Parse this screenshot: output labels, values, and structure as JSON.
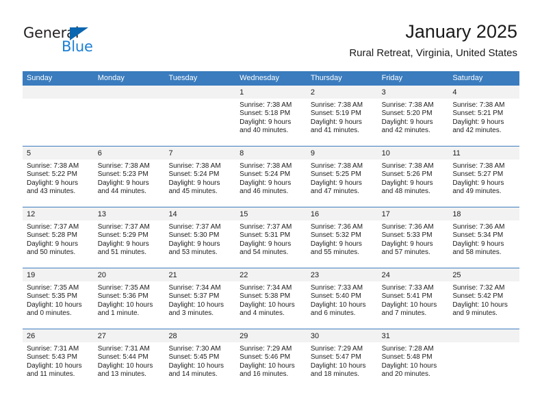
{
  "brand": {
    "name_top": "General",
    "name_bottom": "Blue",
    "triangle_color": "#0a66b0",
    "blue_text_color": "#1b7fd4"
  },
  "header": {
    "title": "January 2025",
    "subtitle": "Rural Retreat, Virginia, United States"
  },
  "theme": {
    "header_blue": "#3a7cbe",
    "day_number_band": "#f2f2f2",
    "text": "#1a1a1a"
  },
  "weekdays": [
    "Sunday",
    "Monday",
    "Tuesday",
    "Wednesday",
    "Thursday",
    "Friday",
    "Saturday"
  ],
  "weeks": [
    [
      {
        "empty": true
      },
      {
        "empty": true
      },
      {
        "empty": true
      },
      {
        "day": "1",
        "sunrise": "Sunrise: 7:38 AM",
        "sunset": "Sunset: 5:18 PM",
        "daylight1": "Daylight: 9 hours",
        "daylight2": "and 40 minutes."
      },
      {
        "day": "2",
        "sunrise": "Sunrise: 7:38 AM",
        "sunset": "Sunset: 5:19 PM",
        "daylight1": "Daylight: 9 hours",
        "daylight2": "and 41 minutes."
      },
      {
        "day": "3",
        "sunrise": "Sunrise: 7:38 AM",
        "sunset": "Sunset: 5:20 PM",
        "daylight1": "Daylight: 9 hours",
        "daylight2": "and 42 minutes."
      },
      {
        "day": "4",
        "sunrise": "Sunrise: 7:38 AM",
        "sunset": "Sunset: 5:21 PM",
        "daylight1": "Daylight: 9 hours",
        "daylight2": "and 42 minutes."
      }
    ],
    [
      {
        "day": "5",
        "sunrise": "Sunrise: 7:38 AM",
        "sunset": "Sunset: 5:22 PM",
        "daylight1": "Daylight: 9 hours",
        "daylight2": "and 43 minutes."
      },
      {
        "day": "6",
        "sunrise": "Sunrise: 7:38 AM",
        "sunset": "Sunset: 5:23 PM",
        "daylight1": "Daylight: 9 hours",
        "daylight2": "and 44 minutes."
      },
      {
        "day": "7",
        "sunrise": "Sunrise: 7:38 AM",
        "sunset": "Sunset: 5:24 PM",
        "daylight1": "Daylight: 9 hours",
        "daylight2": "and 45 minutes."
      },
      {
        "day": "8",
        "sunrise": "Sunrise: 7:38 AM",
        "sunset": "Sunset: 5:24 PM",
        "daylight1": "Daylight: 9 hours",
        "daylight2": "and 46 minutes."
      },
      {
        "day": "9",
        "sunrise": "Sunrise: 7:38 AM",
        "sunset": "Sunset: 5:25 PM",
        "daylight1": "Daylight: 9 hours",
        "daylight2": "and 47 minutes."
      },
      {
        "day": "10",
        "sunrise": "Sunrise: 7:38 AM",
        "sunset": "Sunset: 5:26 PM",
        "daylight1": "Daylight: 9 hours",
        "daylight2": "and 48 minutes."
      },
      {
        "day": "11",
        "sunrise": "Sunrise: 7:38 AM",
        "sunset": "Sunset: 5:27 PM",
        "daylight1": "Daylight: 9 hours",
        "daylight2": "and 49 minutes."
      }
    ],
    [
      {
        "day": "12",
        "sunrise": "Sunrise: 7:37 AM",
        "sunset": "Sunset: 5:28 PM",
        "daylight1": "Daylight: 9 hours",
        "daylight2": "and 50 minutes."
      },
      {
        "day": "13",
        "sunrise": "Sunrise: 7:37 AM",
        "sunset": "Sunset: 5:29 PM",
        "daylight1": "Daylight: 9 hours",
        "daylight2": "and 51 minutes."
      },
      {
        "day": "14",
        "sunrise": "Sunrise: 7:37 AM",
        "sunset": "Sunset: 5:30 PM",
        "daylight1": "Daylight: 9 hours",
        "daylight2": "and 53 minutes."
      },
      {
        "day": "15",
        "sunrise": "Sunrise: 7:37 AM",
        "sunset": "Sunset: 5:31 PM",
        "daylight1": "Daylight: 9 hours",
        "daylight2": "and 54 minutes."
      },
      {
        "day": "16",
        "sunrise": "Sunrise: 7:36 AM",
        "sunset": "Sunset: 5:32 PM",
        "daylight1": "Daylight: 9 hours",
        "daylight2": "and 55 minutes."
      },
      {
        "day": "17",
        "sunrise": "Sunrise: 7:36 AM",
        "sunset": "Sunset: 5:33 PM",
        "daylight1": "Daylight: 9 hours",
        "daylight2": "and 57 minutes."
      },
      {
        "day": "18",
        "sunrise": "Sunrise: 7:36 AM",
        "sunset": "Sunset: 5:34 PM",
        "daylight1": "Daylight: 9 hours",
        "daylight2": "and 58 minutes."
      }
    ],
    [
      {
        "day": "19",
        "sunrise": "Sunrise: 7:35 AM",
        "sunset": "Sunset: 5:35 PM",
        "daylight1": "Daylight: 10 hours",
        "daylight2": "and 0 minutes."
      },
      {
        "day": "20",
        "sunrise": "Sunrise: 7:35 AM",
        "sunset": "Sunset: 5:36 PM",
        "daylight1": "Daylight: 10 hours",
        "daylight2": "and 1 minute."
      },
      {
        "day": "21",
        "sunrise": "Sunrise: 7:34 AM",
        "sunset": "Sunset: 5:37 PM",
        "daylight1": "Daylight: 10 hours",
        "daylight2": "and 3 minutes."
      },
      {
        "day": "22",
        "sunrise": "Sunrise: 7:34 AM",
        "sunset": "Sunset: 5:38 PM",
        "daylight1": "Daylight: 10 hours",
        "daylight2": "and 4 minutes."
      },
      {
        "day": "23",
        "sunrise": "Sunrise: 7:33 AM",
        "sunset": "Sunset: 5:40 PM",
        "daylight1": "Daylight: 10 hours",
        "daylight2": "and 6 minutes."
      },
      {
        "day": "24",
        "sunrise": "Sunrise: 7:33 AM",
        "sunset": "Sunset: 5:41 PM",
        "daylight1": "Daylight: 10 hours",
        "daylight2": "and 7 minutes."
      },
      {
        "day": "25",
        "sunrise": "Sunrise: 7:32 AM",
        "sunset": "Sunset: 5:42 PM",
        "daylight1": "Daylight: 10 hours",
        "daylight2": "and 9 minutes."
      }
    ],
    [
      {
        "day": "26",
        "sunrise": "Sunrise: 7:31 AM",
        "sunset": "Sunset: 5:43 PM",
        "daylight1": "Daylight: 10 hours",
        "daylight2": "and 11 minutes."
      },
      {
        "day": "27",
        "sunrise": "Sunrise: 7:31 AM",
        "sunset": "Sunset: 5:44 PM",
        "daylight1": "Daylight: 10 hours",
        "daylight2": "and 13 minutes."
      },
      {
        "day": "28",
        "sunrise": "Sunrise: 7:30 AM",
        "sunset": "Sunset: 5:45 PM",
        "daylight1": "Daylight: 10 hours",
        "daylight2": "and 14 minutes."
      },
      {
        "day": "29",
        "sunrise": "Sunrise: 7:29 AM",
        "sunset": "Sunset: 5:46 PM",
        "daylight1": "Daylight: 10 hours",
        "daylight2": "and 16 minutes."
      },
      {
        "day": "30",
        "sunrise": "Sunrise: 7:29 AM",
        "sunset": "Sunset: 5:47 PM",
        "daylight1": "Daylight: 10 hours",
        "daylight2": "and 18 minutes."
      },
      {
        "day": "31",
        "sunrise": "Sunrise: 7:28 AM",
        "sunset": "Sunset: 5:48 PM",
        "daylight1": "Daylight: 10 hours",
        "daylight2": "and 20 minutes."
      },
      {
        "empty": true
      }
    ]
  ]
}
